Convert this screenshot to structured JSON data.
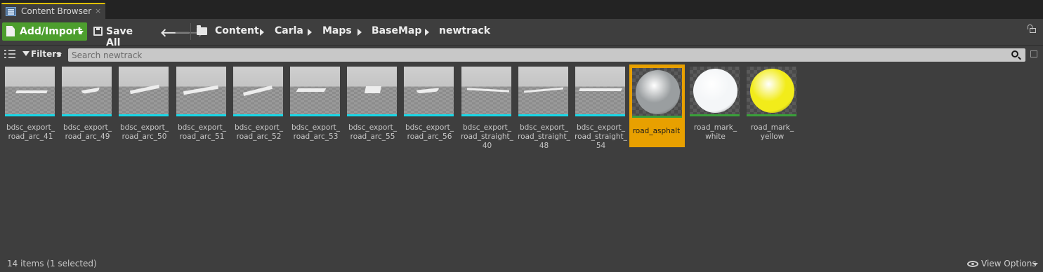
{
  "tab": {
    "title": "Content Browser",
    "close": "×"
  },
  "toolbar": {
    "add_label": "Add/Import",
    "save_label": "Save All",
    "back": "🡐",
    "forward": "🡒"
  },
  "breadcrumb": [
    "Content",
    "Carla",
    "Maps",
    "BaseMap",
    "newtrack"
  ],
  "filters": {
    "label": "Filters",
    "search_placeholder": "Search newtrack"
  },
  "assets": [
    {
      "name": "bdsc_export_ road_arc_41",
      "type": "mesh"
    },
    {
      "name": "bdsc_export_ road_arc_49",
      "type": "mesh"
    },
    {
      "name": "bdsc_export_ road_arc_50",
      "type": "mesh"
    },
    {
      "name": "bdsc_export_ road_arc_51",
      "type": "mesh"
    },
    {
      "name": "bdsc_export_ road_arc_52",
      "type": "mesh"
    },
    {
      "name": "bdsc_export_ road_arc_53",
      "type": "mesh"
    },
    {
      "name": "bdsc_export_ road_arc_55",
      "type": "mesh"
    },
    {
      "name": "bdsc_export_ road_arc_56",
      "type": "mesh"
    },
    {
      "name": "bdsc_export_ road_straight_ 40",
      "type": "mesh"
    },
    {
      "name": "bdsc_export_ road_straight_ 48",
      "type": "mesh"
    },
    {
      "name": "bdsc_export_ road_straight_ 54",
      "type": "mesh"
    },
    {
      "name": "road_asphalt",
      "type": "material",
      "selected": true,
      "sphere_color": "#9a9ea0"
    },
    {
      "name": "road_mark_ white",
      "type": "material",
      "sphere_color": "#f4f6f8"
    },
    {
      "name": "road_mark_ yellow",
      "type": "material",
      "sphere_color": "#f2ec1a"
    }
  ],
  "status": {
    "count_text": "14 items (1 selected)",
    "view_options": "View Options"
  },
  "colors": {
    "add_button": "#4d9e2e",
    "selection": "#e8a000",
    "mesh_underline": "#18d8e8",
    "material_underline": "#3aa03a"
  }
}
